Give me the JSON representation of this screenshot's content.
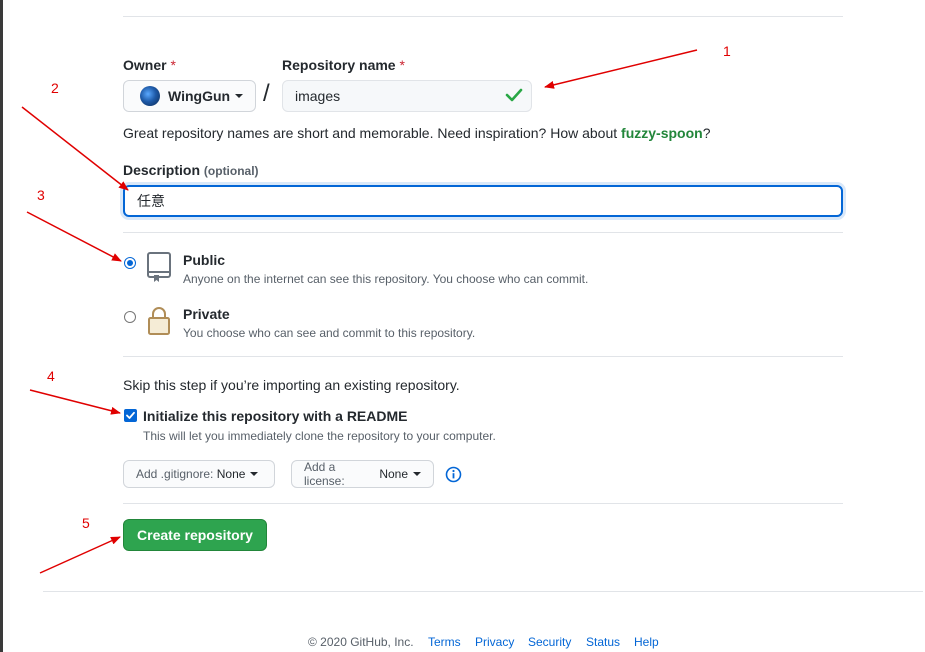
{
  "owner": {
    "label": "Owner",
    "required_mark": "*",
    "value": "WingGun"
  },
  "separator": "/",
  "repo": {
    "label": "Repository name",
    "required_mark": "*",
    "value": "images"
  },
  "hint": {
    "text": "Great repository names are short and memorable. Need inspiration? How about ",
    "suggestion": "fuzzy-spoon",
    "end": "?"
  },
  "description": {
    "label": "Description",
    "optional": "(optional)",
    "value": "任意"
  },
  "visibility": {
    "public": {
      "title": "Public",
      "desc": "Anyone on the internet can see this repository. You choose who can commit.",
      "selected": true
    },
    "private": {
      "title": "Private",
      "desc": "You choose who can see and commit to this repository.",
      "selected": false
    }
  },
  "init": {
    "skip_text": "Skip this step if you’re importing an existing repository.",
    "readme_label": "Initialize this repository with a README",
    "readme_desc": "This will let you immediately clone the repository to your computer.",
    "readme_checked": true
  },
  "gitignore": {
    "prefix": "Add .gitignore:",
    "value": "None"
  },
  "license": {
    "prefix": "Add a license:",
    "value": "None"
  },
  "create_button": "Create repository",
  "footer": {
    "copyright": "© 2020 GitHub, Inc.",
    "links": [
      "Terms",
      "Privacy",
      "Security",
      "Status",
      "Help"
    ]
  },
  "annotations": [
    "1",
    "2",
    "3",
    "4",
    "5"
  ],
  "colors": {
    "accent": "#0366d6",
    "success": "#2ea44f",
    "annotation": "#e00000"
  }
}
